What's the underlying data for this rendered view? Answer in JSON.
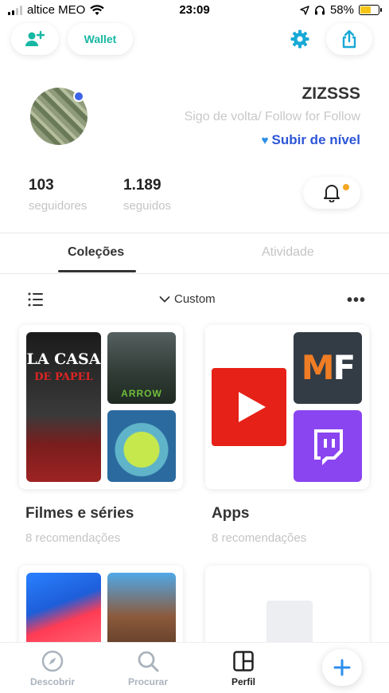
{
  "status_bar": {
    "carrier": "altice MEO",
    "time": "23:09",
    "battery": "58%",
    "battery_level": 0.58
  },
  "header": {
    "wallet_label": "Wallet"
  },
  "profile": {
    "username": "ZIZSSS",
    "bio": "Sigo de volta/ Follow for Follow",
    "level_up": "Subir de nível",
    "followers_count": "103",
    "followers_label": "seguidores",
    "following_count": "1.189",
    "following_label": "seguidos"
  },
  "tabs": [
    {
      "label": "Coleções",
      "active": true
    },
    {
      "label": "Atividade",
      "active": false
    }
  ],
  "filter": {
    "sort_label": "Custom"
  },
  "collections": [
    {
      "title": "Filmes e séries",
      "count": "8 recomendações",
      "thumbs": [
        "LA CASA",
        "DE PAPEL",
        "ARROW"
      ]
    },
    {
      "title": "Apps",
      "count": "8 recomendações",
      "thumbs": [
        "M",
        "F"
      ]
    }
  ],
  "bottom_nav": {
    "discover": "Descobrir",
    "search": "Procurar",
    "profile": "Perfil"
  },
  "colors": {
    "accent_teal": "#18b7a3",
    "accent_blue": "#2d56d6",
    "online_dot": "#3d63e8",
    "notification_dot": "#f5a623"
  }
}
